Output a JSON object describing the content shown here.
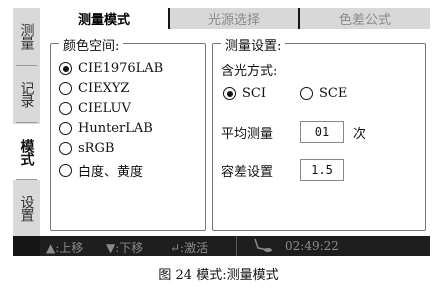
{
  "sidebar": {
    "items": [
      {
        "label": "测量"
      },
      {
        "label": "记录"
      },
      {
        "label": "模式"
      },
      {
        "label": "设置"
      }
    ]
  },
  "tabs": [
    {
      "label": "测量模式"
    },
    {
      "label": "光源选择"
    },
    {
      "label": "色差公式"
    }
  ],
  "color_space": {
    "title": "颜色空间:",
    "options": [
      "CIE1976LAB",
      "CIEXYZ",
      "CIELUV",
      "HunterLAB",
      "sRGB",
      "白度、黄度"
    ],
    "selected": "CIE1976LAB"
  },
  "measure_settings": {
    "title": "测量设置:",
    "gloss_label": "含光方式:",
    "sci_label": "SCI",
    "sce_label": "SCE",
    "gloss_selected": "SCI",
    "avg_label": "平均测量",
    "avg_value": "01",
    "avg_unit": "次",
    "tolerance_label": "容差设置",
    "tolerance_value": "1.5"
  },
  "status_bar": {
    "up": "▲:上移",
    "down": "▼:下移",
    "enter": "↵:激活",
    "time": "02:49:22"
  },
  "caption": "图 24 模式:测量模式"
}
